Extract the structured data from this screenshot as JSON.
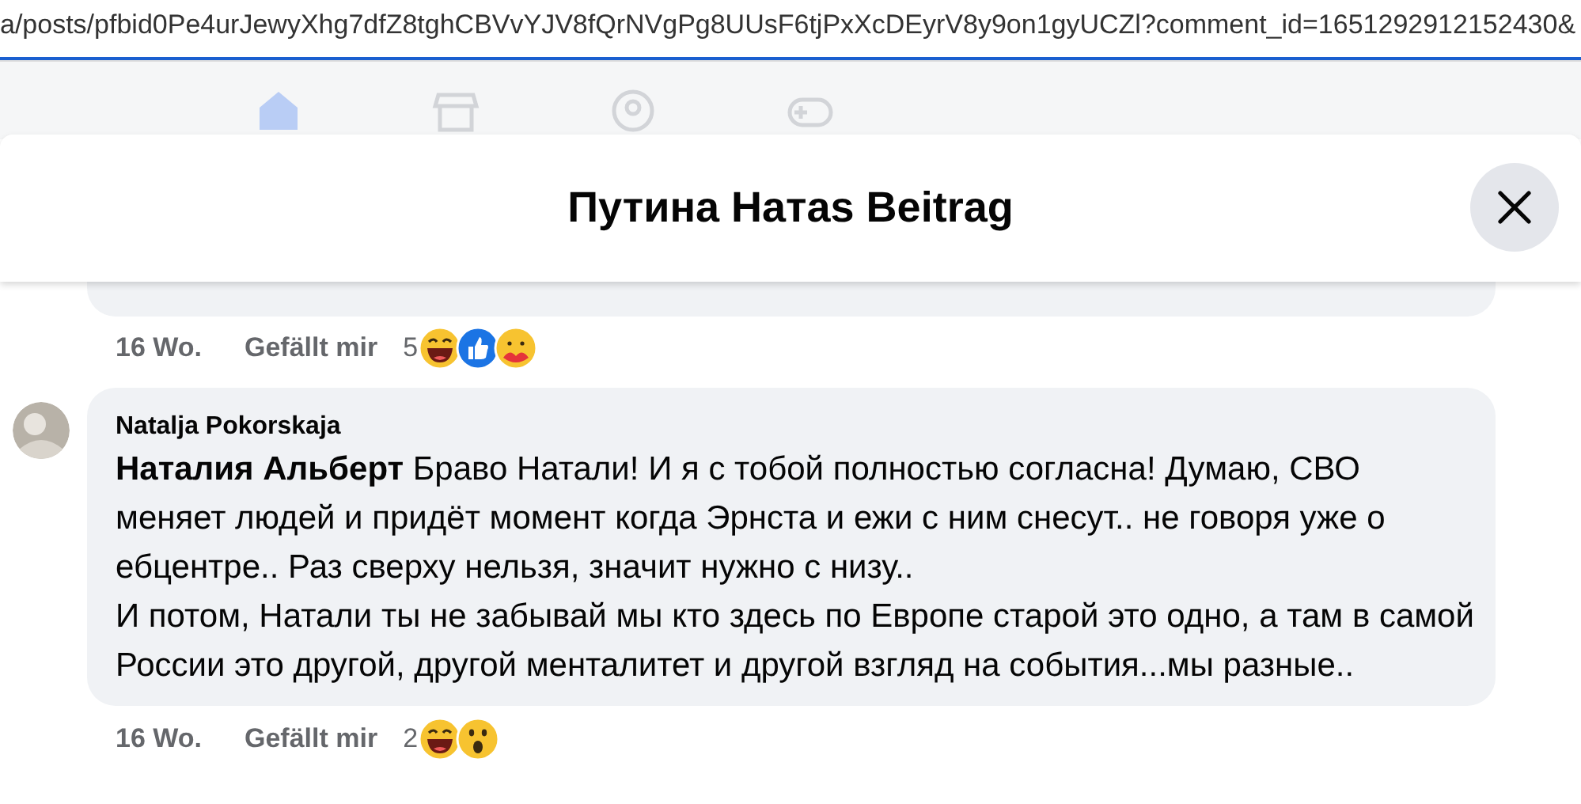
{
  "address_bar": {
    "url": "a/posts/pfbid0Pe4urJewyXhg7dfZ8tghCBVvYJV8fQrNVgPg8UUsF6tjPxXcDEyrV8y9on1gyUCZl?comment_id=1651292912152430&"
  },
  "nav_tabs": [
    {
      "kind": "home",
      "selected": true
    },
    {
      "kind": "market",
      "selected": false
    },
    {
      "kind": "groups",
      "selected": false
    },
    {
      "kind": "gaming",
      "selected": false
    }
  ],
  "dialog": {
    "title": "Путина Натаs Beitrag"
  },
  "comments": [
    {
      "kind": "cut",
      "time": "16 Wo.",
      "like": "Gefällt mir",
      "reaction_count": "5",
      "reactions": [
        {
          "kind": "haha"
        },
        {
          "kind": "like"
        },
        {
          "kind": "care"
        }
      ]
    },
    {
      "author": "Natalja Pokorskaja",
      "text": "**Наталия Альберт** Браво Натали! И я с тобой полностью согласна! Думаю, СВО меняет людей и придёт момент когда Эрнста и ежи с ним снесут.. не говоря уже о ебцентре.. Раз сверху нельзя, значит нужно с низу..\nИ потом, Натали ты не забывай мы кто здесь по Европе старой это одно, а там в самой России это другой, другой менталитет и другой взгляд на события...мы разные..",
      "time": "16 Wo.",
      "like": "Gefällt mir",
      "reaction_count": "2",
      "reactions": [
        {
          "kind": "haha"
        },
        {
          "kind": "wow"
        }
      ]
    }
  ]
}
